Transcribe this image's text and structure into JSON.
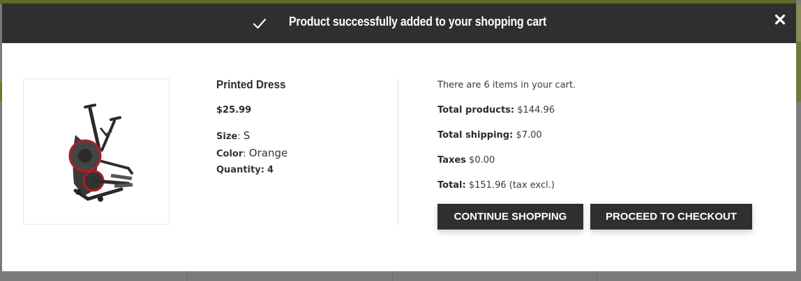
{
  "header": {
    "title": "Product successfully added to your shopping cart"
  },
  "product": {
    "name": "Printed Dress",
    "price": "$25.99",
    "size_label": "Size",
    "size_value": "S",
    "color_label": "Color",
    "color_value": "Orange",
    "quantity_label": "Quantity:",
    "quantity_value": "4"
  },
  "cart": {
    "items_text": "There are 6 items in your cart.",
    "total_products_label": "Total products:",
    "total_products_value": "$144.96",
    "total_shipping_label": "Total shipping:",
    "total_shipping_value": "$7.00",
    "taxes_label": "Taxes",
    "taxes_value": "$0.00",
    "total_label": "Total:",
    "total_value": "$151.96 (tax excl.)"
  },
  "buttons": {
    "continue_label": "CONTINUE SHOPPING",
    "checkout_label": "PROCEED TO CHECKOUT"
  },
  "icons": {
    "header": "check-icon",
    "close": "close-icon"
  },
  "colors": {
    "header_bg": "#2f2f2f",
    "button_bg": "#2f2f2f",
    "accent_green": "#6a7a2a"
  }
}
